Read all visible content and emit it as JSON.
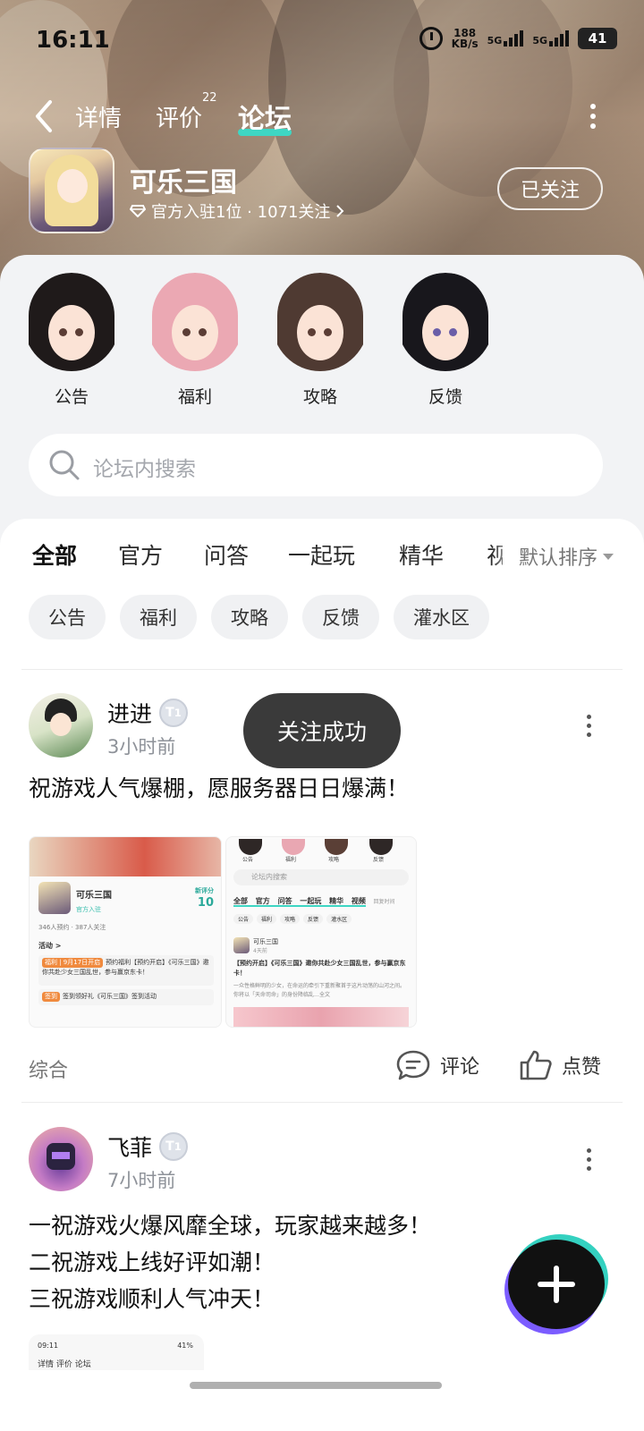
{
  "status_bar": {
    "time": "16:11",
    "net_speed_value": "188",
    "net_speed_unit": "KB/s",
    "sim1": "5G",
    "sim2": "5G",
    "battery": "41"
  },
  "nav": {
    "tabs": [
      {
        "label": "详情"
      },
      {
        "label": "评价",
        "badge": "22"
      },
      {
        "label": "论坛",
        "active": true
      }
    ]
  },
  "game": {
    "name": "可乐三国",
    "meta": "官方入驻1位 · 1071关注",
    "follow_button": "已关注"
  },
  "quick_entries": [
    {
      "label": "公告"
    },
    {
      "label": "福利"
    },
    {
      "label": "攻略"
    },
    {
      "label": "反馈"
    }
  ],
  "search": {
    "placeholder": "论坛内搜索"
  },
  "feed_tabs": [
    {
      "label": "全部",
      "active": true
    },
    {
      "label": "官方"
    },
    {
      "label": "问答"
    },
    {
      "label": "一起玩"
    },
    {
      "label": "精华"
    },
    {
      "label": "视频"
    }
  ],
  "sort": {
    "label": "默认排序"
  },
  "chips": [
    "公告",
    "福利",
    "攻略",
    "反馈",
    "灌水区"
  ],
  "toast": "关注成功",
  "posts": [
    {
      "user": "进进",
      "level": "1",
      "time": "3小时前",
      "text": "祝游戏人气爆棚，愿服务器日日爆满！",
      "category": "综合",
      "comment_label": "评论",
      "like_label": "点赞",
      "thumb1": {
        "name": "可乐三国",
        "tag": "官方入驻",
        "score_label": "新评分",
        "score": "10",
        "stats": "346人预约 · 387人关注",
        "section": "活动 >",
        "item1_pill": "福利 | 9月17日开启",
        "item1_text": "预约福利【预约开启】《可乐三国》邀你共赴少女三国乱世，参与赢京东卡！",
        "item2_pill": "签到",
        "item2_text": "签到领好礼《可乐三国》签到活动"
      },
      "thumb2": {
        "labels": [
          "公告",
          "福利",
          "攻略",
          "反馈"
        ],
        "search": "论坛内搜索",
        "tabs": "全部 官方 问答 一起玩 精华 视频",
        "sort": "回复时间",
        "chips": [
          "公告",
          "福利",
          "攻略",
          "反馈",
          "灌水区"
        ],
        "poster": "可乐三国",
        "time": "4天前",
        "title": "【预约开启】《可乐三国》邀你共赴少女三国乱世，参与赢京东卡！",
        "body": "一众性格鲜明的少女，在命运的牵引下重新聚首于这片动荡的山河之间。你将以「天命司命」的身份降临乱…全文"
      }
    },
    {
      "user": "飞菲",
      "level": "1",
      "time": "7小时前",
      "lines": [
        "一祝游戏火爆风靡全球，玩家越来越多！",
        "二祝游戏上线好评如潮！",
        "三祝游戏顺利人气冲天！"
      ],
      "mini_thumb": {
        "time": "09:11",
        "status": "41%",
        "nav": "详情  评价  论坛"
      }
    }
  ],
  "colors": {
    "accent": "#3ed6c3",
    "toast_bg": "#3a3a3a",
    "fab_bg": "#111111"
  },
  "icons": [
    "back-arrow-icon",
    "more-vert-icon",
    "diamond-icon",
    "chevron-right-icon",
    "search-icon",
    "comment-icon",
    "thumbs-up-icon",
    "plus-icon",
    "alarm-icon",
    "signal-icon",
    "battery-icon"
  ]
}
